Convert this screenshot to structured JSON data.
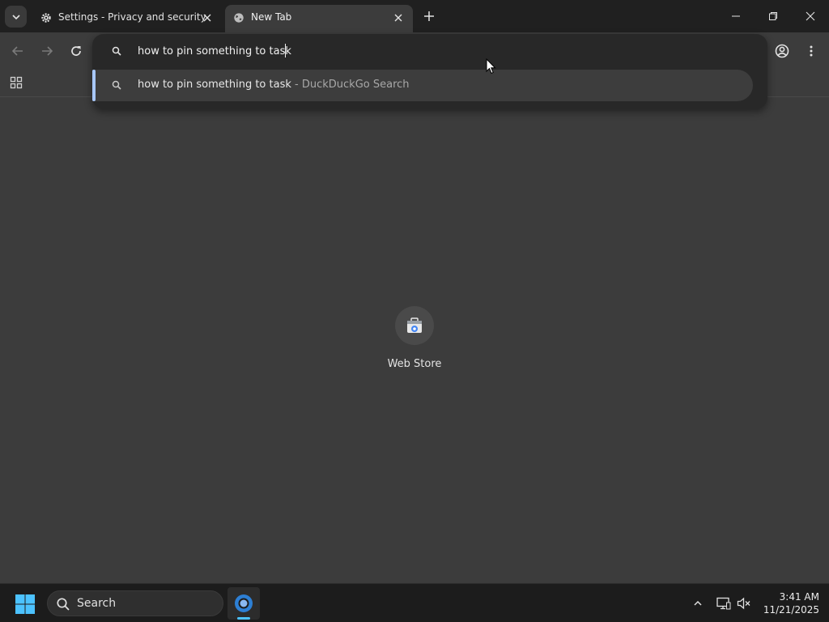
{
  "tabs": [
    {
      "title": "Settings - Privacy and security",
      "icon": "gear-icon",
      "active": false
    },
    {
      "title": "New Tab",
      "icon": "globe-icon",
      "active": true
    }
  ],
  "omnibox": {
    "value": "how to pin something to task",
    "suggestion": {
      "query": "how to pin something to task",
      "separator": " - ",
      "engine": "DuckDuckGo Search"
    }
  },
  "shortcuts": [
    {
      "label": "Web Store",
      "icon": "web-store-icon"
    }
  ],
  "taskbar": {
    "search_label": "Search",
    "time": "3:41 AM",
    "date": "11/21/2025"
  },
  "colors": {
    "page_bg": "#3c3c3c",
    "tabstrip_bg": "#202020",
    "accent": "#a8c7fa",
    "taskbar_indicator": "#4cc2ff"
  }
}
